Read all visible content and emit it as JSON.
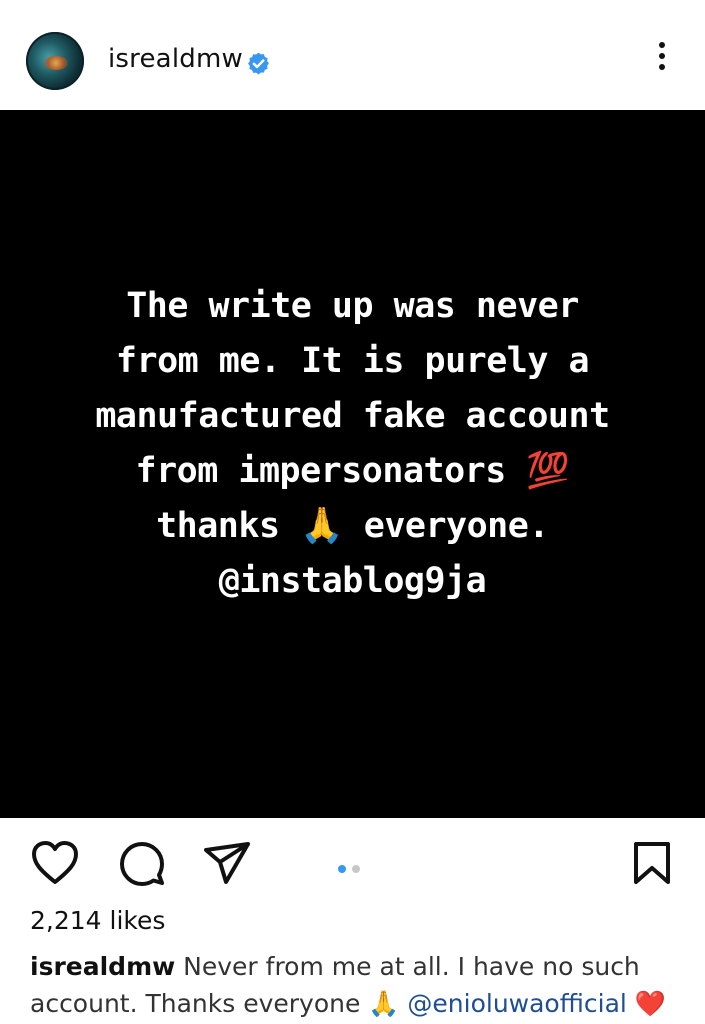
{
  "header": {
    "username": "isrealdmw",
    "verified_color": "#3897f0"
  },
  "post": {
    "text_lines": [
      "The write up was never",
      "from me. It is purely a",
      "manufactured fake account",
      "from impersonators 💯",
      "thanks 🙏 everyone.",
      "@instablog9ja"
    ]
  },
  "actions": {
    "icons": [
      "heart-icon",
      "comment-icon",
      "share-icon",
      "bookmark-icon"
    ],
    "carousel": {
      "count": 2,
      "active_index": 0,
      "active_color": "#3897f0",
      "inactive_color": "#c7c7c7"
    }
  },
  "likes": "2,214 likes",
  "caption": {
    "username": "isrealdmw",
    "text": " Never from me at all. I have no such account. Thanks everyone 🙏 ",
    "mention": "@enioluwaofficial",
    "trailing_emoji": " ❤️"
  }
}
